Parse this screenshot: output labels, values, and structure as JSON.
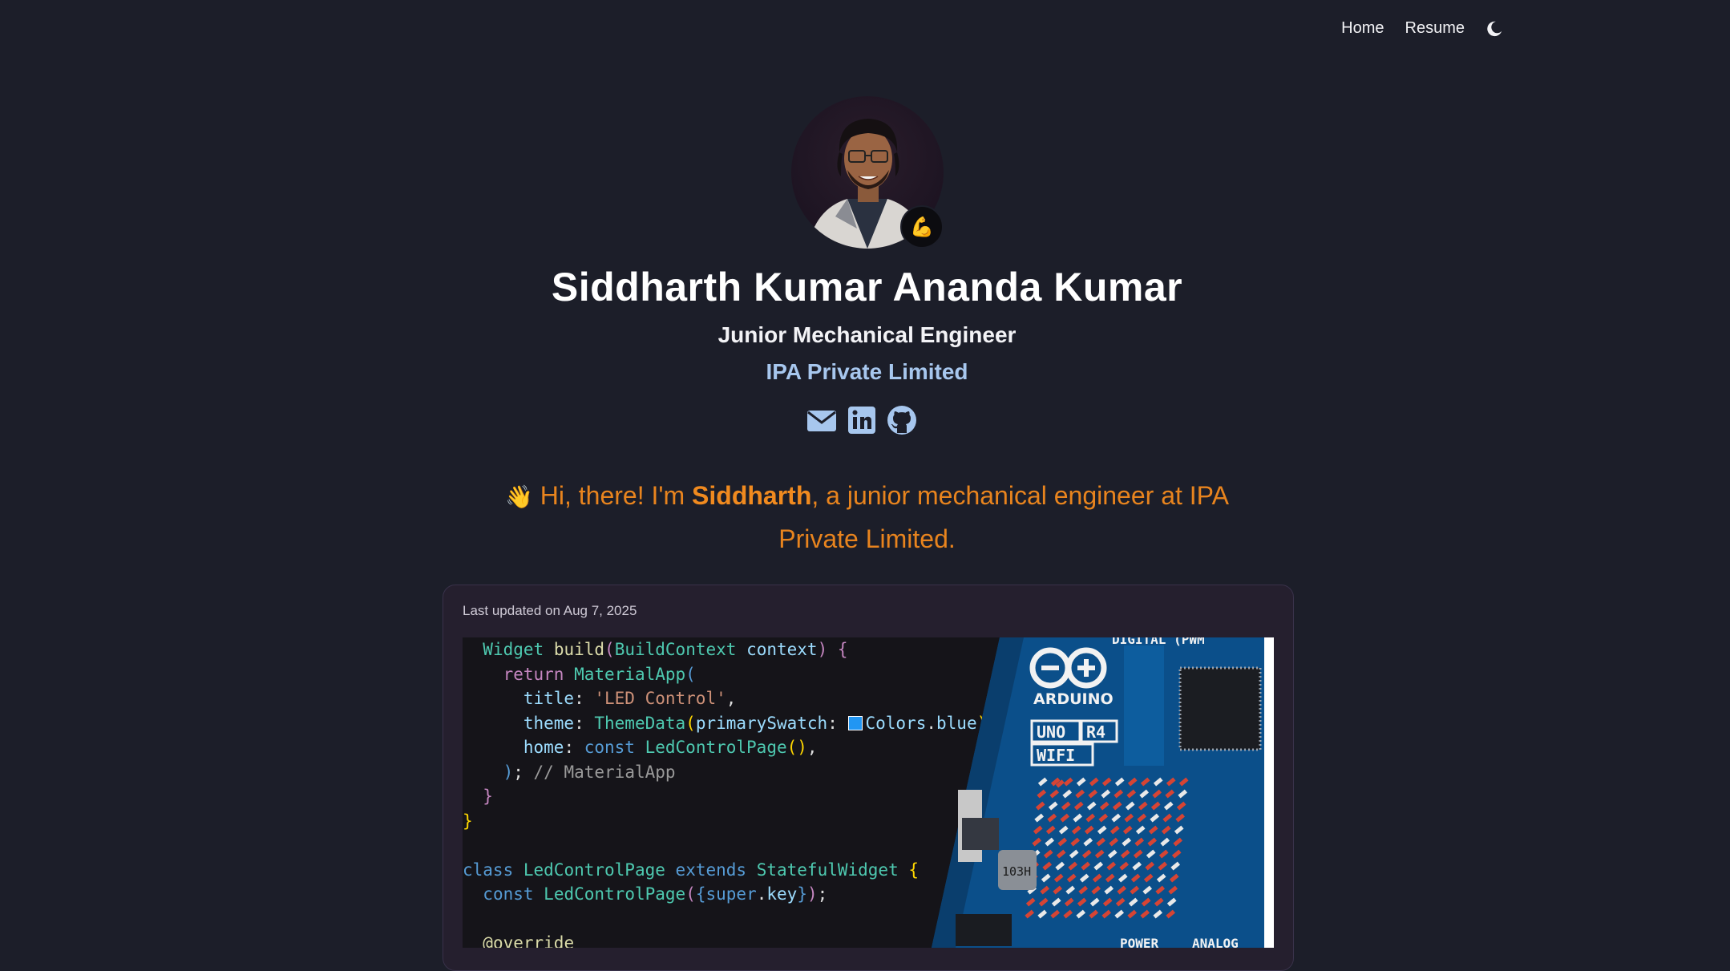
{
  "nav": {
    "items": [
      {
        "label": "Home"
      },
      {
        "label": "Resume"
      }
    ],
    "theme_toggle_icon": "moon-icon"
  },
  "profile": {
    "name": "Siddharth Kumar Ananda Kumar",
    "role": "Junior Mechanical Engineer",
    "company": "IPA Private Limited",
    "avatar_badge_emoji": "💪",
    "social_icons": [
      "envelope-icon",
      "linkedin-icon",
      "github-icon"
    ]
  },
  "intro": {
    "hand": "👋",
    "prefix": "Hi, there! I'm ",
    "name": "Siddharth",
    "suffix": ", a junior mechanical engineer at IPA Private Limited."
  },
  "post": {
    "updated": "Last updated on Aug 7, 2025",
    "board_labels": {
      "brand": "ARDUINO",
      "model_1": "UNO",
      "model_2": "R4",
      "model_3": "WIFI",
      "top": "DIGITAL (PWM",
      "bottom_1": "POWER",
      "bottom_2": "ANALOG",
      "chip": "103H"
    }
  },
  "colors": {
    "background": "#1c1e29",
    "accent_orange": "#e8841e",
    "company_blue": "#a7c7ee",
    "card_bg": "#251f2e"
  }
}
